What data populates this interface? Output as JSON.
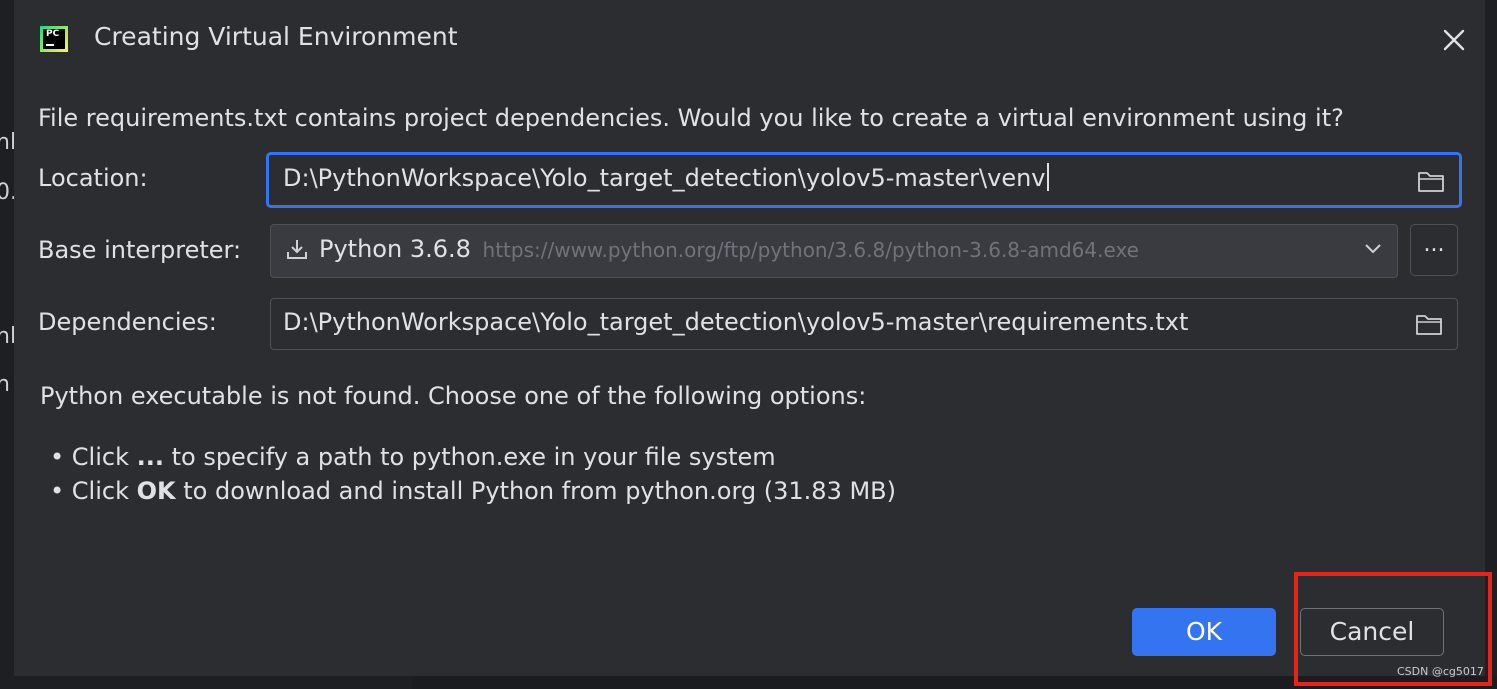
{
  "background": {
    "fragments": [
      "nl",
      "0.",
      "nl",
      "n"
    ]
  },
  "dialog": {
    "title": "Creating Virtual Environment",
    "app_icon_text": "PC",
    "question": "File requirements.txt contains project dependencies. Would you like to create a virtual environment using it?",
    "location": {
      "label": "Location:",
      "value": "D:\\PythonWorkspace\\Yolo_target_detection\\yolov5-master\\venv"
    },
    "interpreter": {
      "label": "Base interpreter:",
      "name": "Python 3.6.8",
      "url": "https://www.python.org/ftp/python/3.6.8/python-3.6.8-amd64.exe",
      "browse_label": "..."
    },
    "dependencies": {
      "label": "Dependencies:",
      "value": "D:\\PythonWorkspace\\Yolo_target_detection\\yolov5-master\\requirements.txt"
    },
    "note": "Python executable is not found. Choose one of the following options:",
    "options": [
      {
        "prefix": "• Click ",
        "bold": "...",
        "suffix": " to specify a path to python.exe in your file system"
      },
      {
        "prefix": "• Click ",
        "bold": "OK",
        "suffix": " to download and install Python from python.org (31.83 MB)"
      }
    ],
    "ok_label": "OK",
    "cancel_label": "Cancel"
  },
  "watermark": "CSDN @cg5017",
  "colors": {
    "accent": "#3574f0",
    "highlight": "#e8231b",
    "background": "#2b2d30"
  }
}
